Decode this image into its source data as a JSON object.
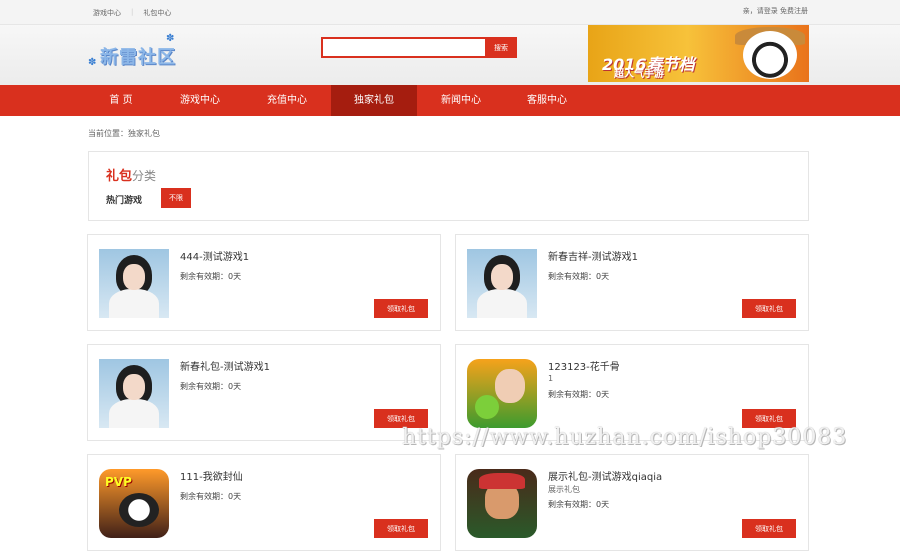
{
  "topbar": {
    "link1": "游戏中心",
    "link2": "礼包中心",
    "login_text": "亲，请登录 免费注册"
  },
  "header": {
    "logo_text": "新雷社区",
    "search_placeholder": "",
    "search_button": "搜索",
    "banner_title": "2016春节档",
    "banner_subtitle": "超人气手游"
  },
  "nav": {
    "items": [
      "首 页",
      "游戏中心",
      "充值中心",
      "独家礼包",
      "新闻中心",
      "客服中心"
    ],
    "active_index": 3
  },
  "breadcrumb": "当前位置：独家礼包",
  "category": {
    "title_highlight": "礼包",
    "title_rest": "分类",
    "hot_label": "热门游戏",
    "filter_button": "不限"
  },
  "gifts": [
    {
      "name": "444-测试游戏1",
      "desc": "",
      "validity": "剩余有效期：0天",
      "button": "领取礼包",
      "thumb": "girl"
    },
    {
      "name": "新春吉祥-测试游戏1",
      "desc": "",
      "validity": "剩余有效期：0天",
      "button": "领取礼包",
      "thumb": "girl"
    },
    {
      "name": "新春礼包-测试游戏1",
      "desc": "",
      "validity": "剩余有效期：0天",
      "button": "领取礼包",
      "thumb": "girl"
    },
    {
      "name": "123123-花千骨",
      "desc": "1",
      "validity": "剩余有效期：0天",
      "button": "领取礼包",
      "thumb": "game1"
    },
    {
      "name": "111-我欲封仙",
      "desc": "",
      "validity": "剩余有效期：0天",
      "button": "领取礼包",
      "thumb": "game2"
    },
    {
      "name": "展示礼包-测试游戏qiaqia",
      "desc": "展示礼包",
      "validity": "剩余有效期：0天",
      "button": "领取礼包",
      "thumb": "game3"
    }
  ],
  "watermark": "https://www.huzhan.com/ishop30083",
  "colors": {
    "accent": "#d9301e",
    "nav_active": "#a51d0f"
  }
}
